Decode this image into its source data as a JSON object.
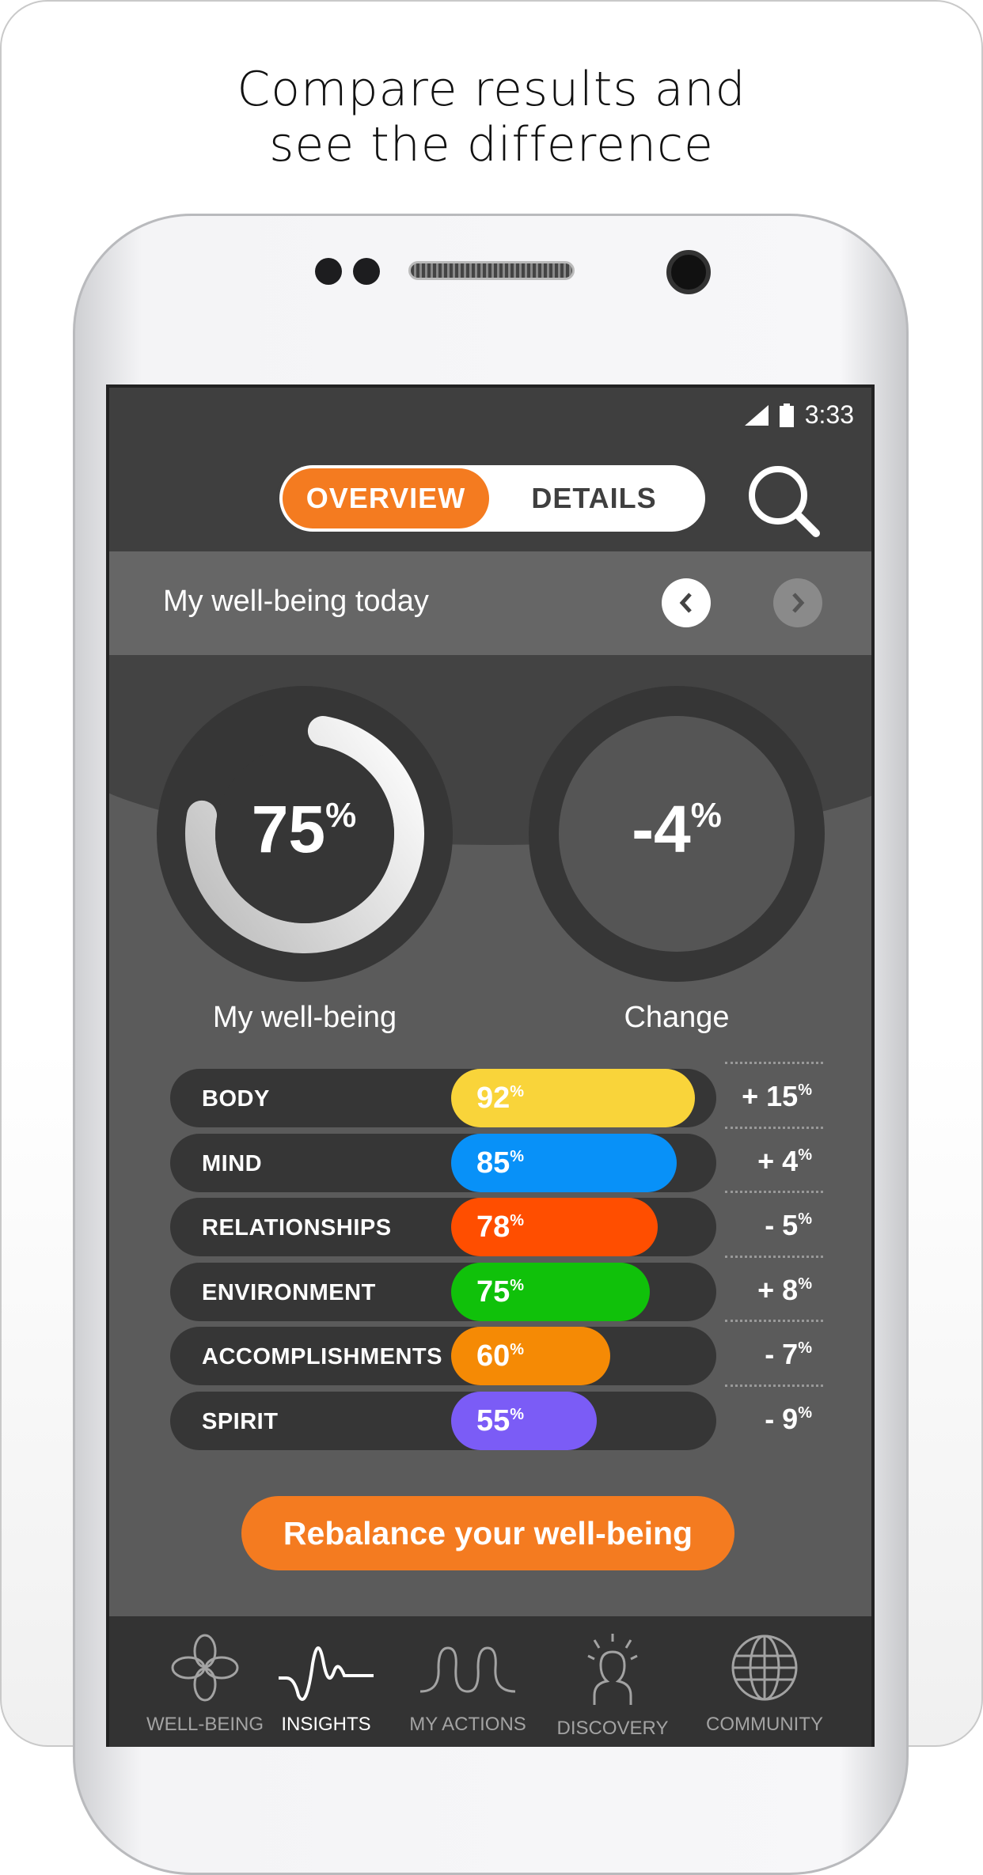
{
  "headline": {
    "line1": "Compare results and",
    "line2": "see the difference"
  },
  "status": {
    "time": "3:33",
    "icons": [
      "signal-icon",
      "battery-icon"
    ]
  },
  "toggle": {
    "overview": "OVERVIEW",
    "details": "DETAILS",
    "active": "OVERVIEW"
  },
  "day": {
    "title": "My well-being today"
  },
  "rings": {
    "wellbeing": {
      "value": "75",
      "unit": "%",
      "label": "My well-being",
      "fraction": 0.75
    },
    "change": {
      "value": "-4",
      "unit": "%",
      "label": "Change"
    }
  },
  "categories": [
    {
      "name": "BODY",
      "value": "92",
      "change": "+ 15",
      "color": "#f9d43a"
    },
    {
      "name": "MIND",
      "value": "85",
      "change": "+ 4",
      "color": "#0891f8"
    },
    {
      "name": "RELATIONSHIPS",
      "value": "78",
      "change": "- 5",
      "color": "#ff4e00"
    },
    {
      "name": "ENVIRONMENT",
      "value": "75",
      "change": "+ 8",
      "color": "#10c10a"
    },
    {
      "name": "ACCOMPLISHMENTS",
      "value": "60",
      "change": "- 7",
      "color": "#f58a05"
    },
    {
      "name": "SPIRIT",
      "value": "55",
      "change": "- 9",
      "color": "#7b5cf6"
    }
  ],
  "percent": "%",
  "cta": "Rebalance your well-being",
  "nav": [
    {
      "label": "WELL-BEING",
      "icon": "flower-icon"
    },
    {
      "label": "INSIGHTS",
      "icon": "wave-icon",
      "active": true
    },
    {
      "label": "MY ACTIONS",
      "icon": "loops-icon"
    },
    {
      "label": "DISCOVERY",
      "icon": "lightbulb-person-icon"
    },
    {
      "label": "COMMUNITY",
      "icon": "globe-icon"
    }
  ],
  "colors": {
    "accent": "#f47b20"
  }
}
